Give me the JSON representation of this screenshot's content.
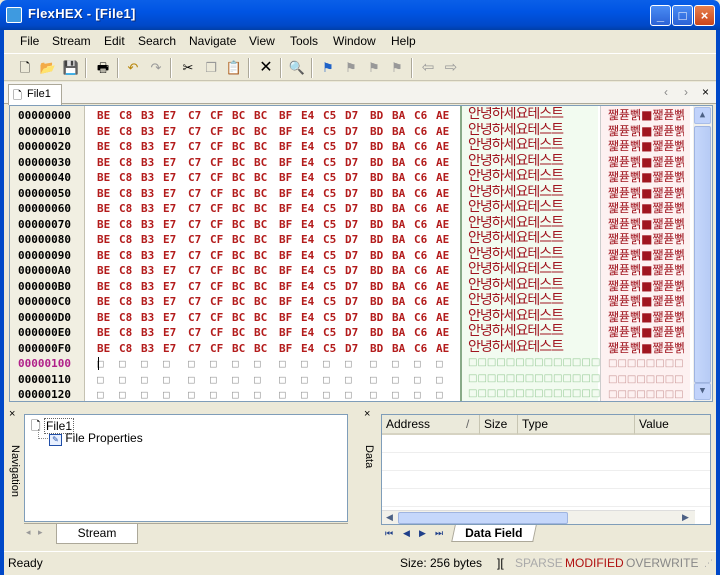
{
  "window": {
    "title": "FlexHEX - [File1]",
    "buttons": [
      "_",
      "□",
      "×"
    ]
  },
  "menu": [
    "File",
    "Stream",
    "Edit",
    "Search",
    "Navigate",
    "View",
    "Tools",
    "Window",
    "Help"
  ],
  "toolbar": {
    "icons": [
      "new-icon",
      "open-icon",
      "save-icon",
      "print-icon",
      "undo-icon",
      "redo-icon",
      "cut-icon",
      "copy-icon",
      "paste-icon",
      "delete-icon",
      "find-icon",
      "flag-icon",
      "flag-prev-icon",
      "flag-next-icon",
      "flag-clear-icon",
      "back-icon",
      "forward-icon"
    ]
  },
  "document_tab": {
    "label": "File1",
    "nav": [
      "‹",
      "›",
      "×"
    ]
  },
  "hex": {
    "addresses": [
      "00000000",
      "00000010",
      "00000020",
      "00000030",
      "00000040",
      "00000050",
      "00000060",
      "00000070",
      "00000080",
      "00000090",
      "000000A0",
      "000000B0",
      "000000C0",
      "000000D0",
      "000000E0",
      "000000F0",
      "00000100",
      "00000110",
      "00000120"
    ],
    "bytes": [
      "BE",
      "C8",
      "B3",
      "E7",
      "C7",
      "CF",
      "BC",
      "BC",
      "BF",
      "E4",
      "C5",
      "D7",
      "BD",
      "BA",
      "C6",
      "AE"
    ],
    "ascii_text": "안녕하세요테스트",
    "ascii2_text": "쨅퓯뻵■쨅퓯뻵■",
    "filled_rows": 16,
    "empty_cell": "□"
  },
  "nav_panel": {
    "label": "Navigation",
    "tree": [
      {
        "label": "File1"
      },
      {
        "label": "File Properties"
      }
    ],
    "tab": "Stream"
  },
  "data_panel": {
    "label": "Data",
    "columns": [
      "Address",
      "Size",
      "Type",
      "Value"
    ],
    "sort_indicator": "/",
    "tab": "Data Field",
    "nav": [
      "⏮",
      "◀",
      "▶",
      "⏭"
    ]
  },
  "status": {
    "ready": "Ready",
    "size": "Size: 256 bytes",
    "sep": "][",
    "sparse": "SPARSE",
    "modified": "MODIFIED",
    "overwrite": "OVERWRITE"
  },
  "colors": {
    "title": "#0054e3",
    "hex_text": "#b31b1b",
    "cursor_addr": "#b0208a",
    "modified": "#b01010"
  }
}
